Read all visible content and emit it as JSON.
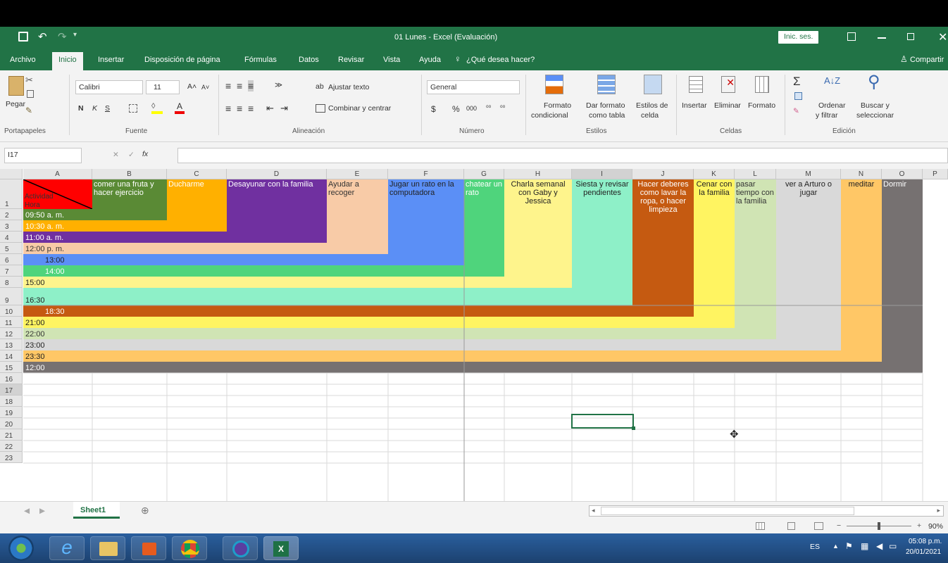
{
  "window": {
    "title": "01 Lunes  -  Excel (Evaluación)",
    "signin": "Inic. ses.",
    "qat_icons": [
      "save-icon",
      "undo-icon",
      "redo-icon",
      "customize-icon"
    ]
  },
  "tabs": [
    "Archivo",
    "Inicio",
    "Insertar",
    "Disposición de página",
    "Fórmulas",
    "Datos",
    "Revisar",
    "Vista",
    "Ayuda",
    "¿Qué desea hacer?",
    "Compartir"
  ],
  "ribbon": {
    "clipboard": {
      "paste": "Pegar",
      "group": "Portapapeles"
    },
    "font": {
      "name": "Calibri",
      "size": "11",
      "bold": "N",
      "italic": "K",
      "underline": "S",
      "group": "Fuente"
    },
    "alignment": {
      "wrap": "Ajustar texto",
      "merge": "Combinar y centrar",
      "group": "Alineación"
    },
    "number": {
      "format": "General",
      "currency": "$",
      "percent": "%",
      "thousands": "000",
      "group": "Número"
    },
    "styles": {
      "conditional": "Formato",
      "conditional2": "condicional",
      "table": "Dar formato",
      "table2": "como tabla",
      "cell": "Estilos de",
      "cell2": "celda",
      "group": "Estilos"
    },
    "cells": {
      "insert": "Insertar",
      "delete": "Eliminar",
      "format": "Formato",
      "group": "Celdas"
    },
    "editing": {
      "sort": "Ordenar",
      "sort2": "y filtrar",
      "find": "Buscar y",
      "find2": "seleccionar",
      "group": "Edición"
    }
  },
  "formula_bar": {
    "name_box": "I17",
    "fx": "fx",
    "value": ""
  },
  "columns": [
    "A",
    "B",
    "C",
    "D",
    "E",
    "F",
    "G",
    "H",
    "I",
    "J",
    "K",
    "L",
    "M",
    "N",
    "O",
    "P"
  ],
  "rows": [
    "1",
    "2",
    "3",
    "4",
    "5",
    "6",
    "7",
    "8",
    "9",
    "10",
    "11",
    "12",
    "13",
    "14",
    "15",
    "16",
    "17",
    "18",
    "19",
    "20",
    "21",
    "22",
    "23"
  ],
  "a1": {
    "top": "Actividad",
    "bottom": "Hora"
  },
  "headers": [
    "comer una fruta y hacer ejercicio",
    "Ducharme",
    "Desayunar con la familia",
    "Ayudar a recoger",
    "Jugar un rato en la computadora",
    "chatear un rato",
    "Charla semanal con Gaby y Jessica",
    "Siesta y revisar pendientes",
    "Hacer deberes como lavar la ropa, o hacer limpieza",
    "Cenar con la familia",
    "pasar tiempo con la familia",
    "ver a Arturo o jugar",
    "meditar",
    "Dormir"
  ],
  "times": [
    "09:50 a. m.",
    "10:30 a. m.",
    "11:00 a. m.",
    "12:00 p. m.",
    "13:00",
    "14:00",
    "15:00",
    "16:30",
    "18:30",
    "21:00",
    "22:00",
    "23:00",
    "23:30",
    "12:00"
  ],
  "colors": [
    "#5a8a35",
    "#ffb000",
    "#7030a0",
    "#f8cba7",
    "#5b8ff6",
    "#4fd47c",
    "#fef48c",
    "#8ef0c8",
    "#c55a11",
    "#fff461",
    "#d0e4b4",
    "#d9d9d9",
    "#ffc766",
    "#767171"
  ],
  "sheet": {
    "tab": "Sheet1"
  },
  "status": {
    "zoom": "90%"
  },
  "taskbar": {
    "lang": "ES",
    "time": "05:08 p.m.",
    "date": "20/01/2021"
  }
}
